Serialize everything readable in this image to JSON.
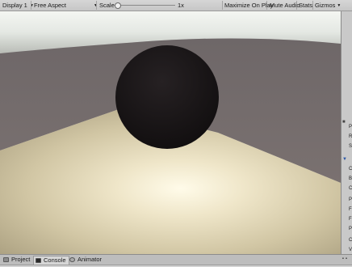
{
  "toolbar": {
    "display": "Display 1",
    "aspect": "Free Aspect",
    "scale_label": "Scale",
    "scale_value": "1x",
    "scale_fraction": 0.0,
    "maximize": "Maximize On Play",
    "mute": "Mute Audio",
    "stats": "Stats",
    "gizmos": "Gizmos"
  },
  "bottom_tabs": [
    {
      "label": "Project",
      "icon": "folder-icon"
    },
    {
      "label": "Console",
      "icon": "console-icon",
      "active": true
    },
    {
      "label": "Animator",
      "icon": "animator-icon"
    }
  ],
  "inspector_fragments": [
    "P",
    "R",
    "S",
    "C",
    "B",
    "C",
    "P",
    "F",
    "F",
    "P",
    "C",
    "V"
  ],
  "colors": {
    "sky": "#e8ebe6",
    "wall": "#6f6666",
    "floor": "#d6ccab",
    "sphere": "#1a1618"
  }
}
